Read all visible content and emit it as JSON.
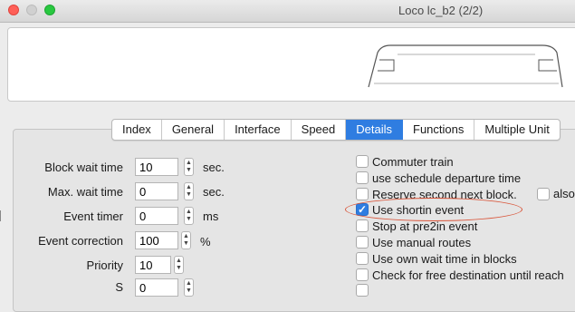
{
  "window": {
    "title": "Loco lc_b2 (2/2)"
  },
  "tabs": [
    {
      "label": "Index"
    },
    {
      "label": "General"
    },
    {
      "label": "Interface"
    },
    {
      "label": "Speed"
    },
    {
      "label": "Details"
    },
    {
      "label": "Functions"
    },
    {
      "label": "Multiple Unit"
    }
  ],
  "active_tab": "Details",
  "fields": [
    {
      "label": "Block wait time",
      "value": "10",
      "unit": "sec."
    },
    {
      "label": "Max. wait time",
      "value": "0",
      "unit": "sec."
    },
    {
      "label": "Event timer",
      "value": "0",
      "unit": "ms"
    },
    {
      "label": "Event correction",
      "value": "100",
      "unit": "%"
    },
    {
      "label": "Priority",
      "value": "10",
      "unit": ""
    },
    {
      "label": "S",
      "value": "0",
      "unit": ""
    }
  ],
  "checkboxes": [
    {
      "label": "Commuter train",
      "checked": false
    },
    {
      "label": "use schedule departure time",
      "checked": false
    },
    {
      "label": "Reserve second next block.",
      "checked": false
    },
    {
      "label": "Use shortin event",
      "checked": true
    },
    {
      "label": "Stop at pre2in event",
      "checked": false
    },
    {
      "label": "Use manual routes",
      "checked": false
    },
    {
      "label": "Use own wait time in blocks",
      "checked": false
    },
    {
      "label": "Check for free destination until reach",
      "checked": false
    },
    {
      "label": "",
      "checked": false
    }
  ],
  "extra_checkbox": {
    "label": "also",
    "checked": false
  },
  "annotation_color": "#d9553a",
  "accent_color": "#2f7de1"
}
